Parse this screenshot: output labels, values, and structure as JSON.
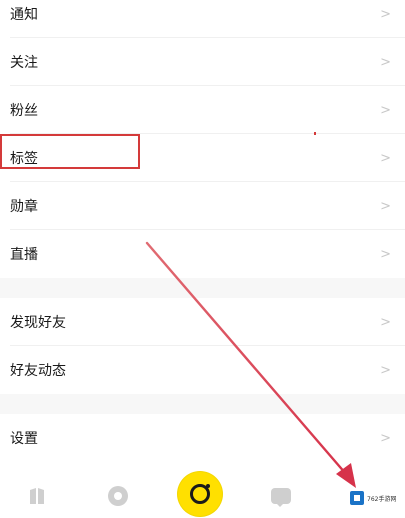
{
  "menu": {
    "items": [
      {
        "label": "通知"
      },
      {
        "label": "关注"
      },
      {
        "label": "粉丝"
      },
      {
        "label": "标签"
      },
      {
        "label": "勋章"
      },
      {
        "label": "直播"
      },
      {
        "label": "发现好友"
      },
      {
        "label": "好友动态"
      },
      {
        "label": "设置"
      }
    ],
    "chevron": ">"
  },
  "colors": {
    "annotation_red": "#d43a3a",
    "camera_yellow": "#ffe000"
  },
  "tabbar": {
    "icons": [
      "docs-icon",
      "explore-icon",
      "camera-icon",
      "message-icon"
    ]
  },
  "watermark": {
    "text": "762手游网"
  }
}
